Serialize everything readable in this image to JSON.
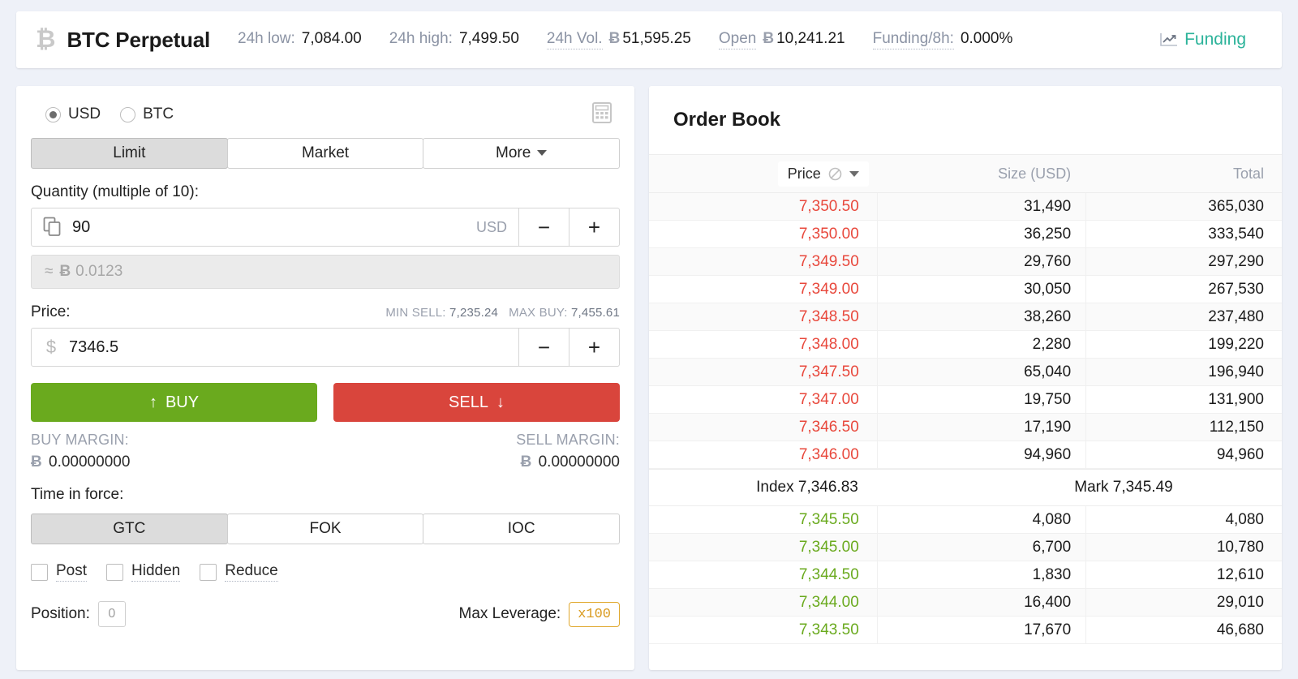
{
  "header": {
    "symbol_icon": "bitcoin-icon",
    "title": "BTC Perpetual",
    "stats": [
      {
        "label": "24h low:",
        "value": "7,084.00",
        "dotted": false,
        "btc": false
      },
      {
        "label": "24h high:",
        "value": "7,499.50",
        "dotted": false,
        "btc": false
      },
      {
        "label": "24h Vol.",
        "value": "51,595.25",
        "dotted": true,
        "btc": true
      },
      {
        "label": "Open",
        "value": "10,241.21",
        "dotted": true,
        "btc": true
      },
      {
        "label": "Funding/8h:",
        "value": "0.000%",
        "dotted": true,
        "btc": false
      }
    ],
    "funding_link": "Funding"
  },
  "order_form": {
    "currency_options": [
      {
        "label": "USD",
        "selected": true
      },
      {
        "label": "BTC",
        "selected": false
      }
    ],
    "calculator_icon": "calculator-icon",
    "order_types": [
      {
        "label": "Limit",
        "active": true,
        "caret": false
      },
      {
        "label": "Market",
        "active": false,
        "caret": false
      },
      {
        "label": "More",
        "active": false,
        "caret": true
      }
    ],
    "quantity": {
      "label": "Quantity (multiple of 10):",
      "value": "90",
      "unit": "USD",
      "icon": "copy-icon",
      "minus": "−",
      "plus": "+",
      "approx_prefix": "≈",
      "approx_symbol": "Ƀ",
      "approx_value": "0.0123"
    },
    "price": {
      "label": "Price:",
      "value": "7346.5",
      "currency_icon": "dollar-icon",
      "min_sell_label": "MIN SELL:",
      "min_sell_value": "7,235.24",
      "max_buy_label": "MAX BUY:",
      "max_buy_value": "7,455.61",
      "minus": "−",
      "plus": "+"
    },
    "buy_button": {
      "label": "BUY",
      "arrow": "↑",
      "color": "#6aaa1e"
    },
    "sell_button": {
      "label": "SELL",
      "arrow": "↓",
      "color": "#d9453c"
    },
    "buy_margin": {
      "label": "BUY MARGIN:",
      "symbol": "Ƀ",
      "value": "0.00000000"
    },
    "sell_margin": {
      "label": "SELL MARGIN:",
      "symbol": "Ƀ",
      "value": "0.00000000"
    },
    "time_in_force": {
      "label": "Time in force:",
      "options": [
        {
          "label": "GTC",
          "active": true
        },
        {
          "label": "FOK",
          "active": false
        },
        {
          "label": "IOC",
          "active": false
        }
      ]
    },
    "checkboxes": [
      {
        "label": "Post",
        "checked": false
      },
      {
        "label": "Hidden",
        "checked": false
      },
      {
        "label": "Reduce",
        "checked": false
      }
    ],
    "position": {
      "label": "Position:",
      "value": "0"
    },
    "leverage": {
      "label": "Max Leverage:",
      "value": "x100",
      "color": "#d99b1f"
    }
  },
  "order_book": {
    "title": "Order Book",
    "columns": {
      "price": "Price",
      "price_icon": "no-entry-icon",
      "size": "Size (USD)",
      "total": "Total"
    },
    "asks": [
      {
        "price": "7,350.50",
        "size": "31,490",
        "total": "365,030"
      },
      {
        "price": "7,350.00",
        "size": "36,250",
        "total": "333,540"
      },
      {
        "price": "7,349.50",
        "size": "29,760",
        "total": "297,290"
      },
      {
        "price": "7,349.00",
        "size": "30,050",
        "total": "267,530"
      },
      {
        "price": "7,348.50",
        "size": "38,260",
        "total": "237,480"
      },
      {
        "price": "7,348.00",
        "size": "2,280",
        "total": "199,220"
      },
      {
        "price": "7,347.50",
        "size": "65,040",
        "total": "196,940"
      },
      {
        "price": "7,347.00",
        "size": "19,750",
        "total": "131,900"
      },
      {
        "price": "7,346.50",
        "size": "17,190",
        "total": "112,150"
      },
      {
        "price": "7,346.00",
        "size": "94,960",
        "total": "94,960"
      }
    ],
    "mid": {
      "index_label": "Index",
      "index_value": "7,346.83",
      "mark_label": "Mark",
      "mark_value": "7,345.49"
    },
    "bids": [
      {
        "price": "7,345.50",
        "size": "4,080",
        "total": "4,080"
      },
      {
        "price": "7,345.00",
        "size": "6,700",
        "total": "10,780"
      },
      {
        "price": "7,344.50",
        "size": "1,830",
        "total": "12,610"
      },
      {
        "price": "7,344.00",
        "size": "16,400",
        "total": "29,010"
      },
      {
        "price": "7,343.50",
        "size": "17,670",
        "total": "46,680"
      }
    ],
    "ask_color": "#e8483c",
    "bid_color": "#6aaa1e"
  }
}
